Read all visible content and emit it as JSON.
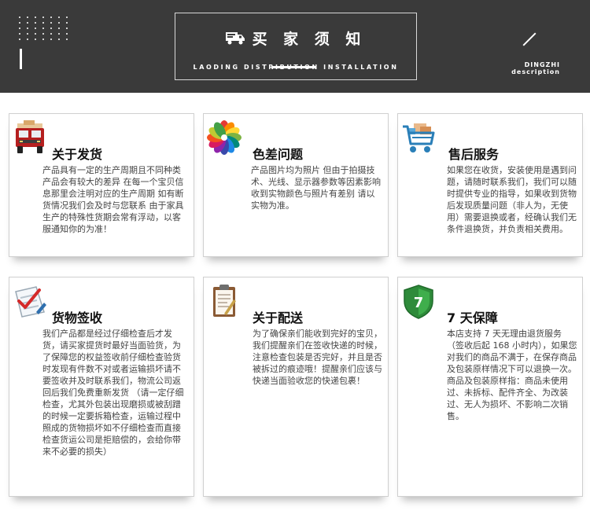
{
  "header": {
    "title": "买 家 须 知",
    "subtitle": "LAODING DISTRIBUTION INSTALLATION",
    "right_label_line1": "DINGZHI",
    "right_label_line2": "description"
  },
  "cards": [
    {
      "icon": "delivery-truck-icon",
      "title": "关于发货",
      "text": "产品具有一定的生产周期且不同种类产品会有较大的差异 在每一个宝贝信息那里会注明对应的生产周期 如有断货情况我们会及时与您联系 由于家具生产的特殊性货期会常有浮动，以客服通知你的为准！"
    },
    {
      "icon": "color-palette-icon",
      "title": "色差问题",
      "text": "产品图片均为照片 但由于拍摄技术、光线、显示器参数等因素影响 收到实物颜色与照片有差别 请以实物为准。"
    },
    {
      "icon": "shopping-cart-icon",
      "title": "售后服务",
      "text": "如果您在收货，安装使用是遇到问题，请随时联系我们，我们可以随时提供专业的指导，如果收到货物后发现质量问题（非人为，无使用）需要退换或者，经确认我们无条件退换货，并负责相关费用。"
    },
    {
      "icon": "checklist-icon",
      "title": "货物签收",
      "text": "我们产品都是经过仔细检查后才发货，请买家提货时最好当面验货，为了保障您的权益签收前仔细检查验货时发现有件数不对或者运输损坏请不要签收并及时联系我们，物流公司返回后我们免费重新发货 （请一定仔细检查，尤其外包装出现磨损或被刮蹭的时候一定要拆箱检查，运输过程中照成的货物损坏如不仔细检查而直接检查货运公司是拒赔偿的，会给你带来不必要的损失）"
    },
    {
      "icon": "clipboard-icon",
      "title": "关于配送",
      "text": "为了确保亲们能收到完好的宝贝，我们提醒亲们在签收快递的时候，注意检查包装是否完好，并且是否被拆过的痕迹哦！提醒亲们应该与快递当面验收您的快递包裹！"
    },
    {
      "icon": "shield-icon",
      "title": "7 天保障",
      "badge": "7",
      "text": "本店支持 7 天无理由退货服务（签收后起 168 小时内），如果您对我们的商品不满于，在保存商品及包装原样情况下可以退换一次。商品及包装原样指：商品未使用过、未拆标、配件齐全、为改装过、无人为损坏、不影响二次销售。"
    }
  ],
  "colors": {
    "header_bg": "#3a3a3a",
    "card_border": "#cfcfcf",
    "title_color": "#111111",
    "text_color": "#444444"
  }
}
